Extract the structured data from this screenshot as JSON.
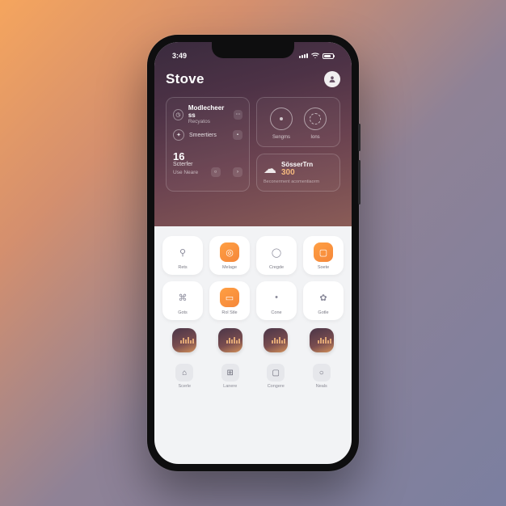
{
  "status": {
    "time": "3:49"
  },
  "header": {
    "title": "Stove"
  },
  "cards": {
    "left": {
      "row1_label": "Modlecheer ss",
      "row1_sub": "Recyatos",
      "row2_label": "Smeertiers",
      "num": "16",
      "num_label": "Scterfer",
      "num_sub": "Use Neare"
    },
    "right_top": {
      "ring1_label": "Sengms",
      "ring2_label": "Ions"
    },
    "right_bottom": {
      "title": "SösserTrn",
      "value": "300",
      "sub": "Beconerment acomentiaorm"
    }
  },
  "grid": {
    "r1": [
      {
        "label": "Rets",
        "accent": false,
        "icon": "pin"
      },
      {
        "label": "Melage",
        "accent": true,
        "icon": "target"
      },
      {
        "label": "Cregde",
        "accent": false,
        "icon": "ring"
      },
      {
        "label": "Soete",
        "accent": true,
        "icon": "square"
      }
    ],
    "r2": [
      {
        "label": "Gots",
        "accent": false,
        "icon": "link"
      },
      {
        "label": "Rol Stle",
        "accent": true,
        "icon": "rect"
      },
      {
        "label": "Cone",
        "accent": false,
        "icon": "dot"
      },
      {
        "label": "Gotle",
        "accent": false,
        "icon": "paw"
      }
    ]
  },
  "row3": [
    "",
    "",
    "",
    ""
  ],
  "nav": [
    {
      "label": "Scerle",
      "icon": "home"
    },
    {
      "label": "Lanere",
      "icon": "grid"
    },
    {
      "label": "Congere",
      "icon": "square"
    },
    {
      "label": "Neals",
      "icon": "circle"
    }
  ]
}
